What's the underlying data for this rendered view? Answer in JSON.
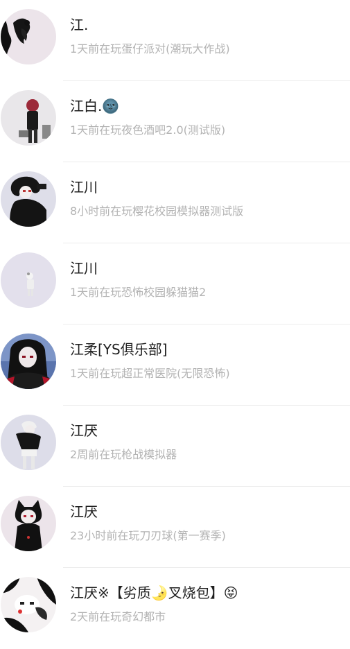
{
  "friends": [
    {
      "name": "江.",
      "status": "1天前在玩蛋仔派对(潮玩大作战)",
      "avatar_icon": "avatar-black-smoke-icon"
    },
    {
      "name": "江白.🌚",
      "status": "1天前在玩夜色酒吧2.0(测试版)",
      "avatar_icon": "avatar-red-hair-figure-icon"
    },
    {
      "name": "江川",
      "status": "8小时前在玩樱花校园模拟器测试版",
      "avatar_icon": "avatar-dark-hair-pose-icon"
    },
    {
      "name": "江川",
      "status": "1天前在玩恐怖校园躲猫猫2",
      "avatar_icon": "avatar-small-white-figure-icon"
    },
    {
      "name": "江柔[YS俱乐部]",
      "status": "1天前在玩超正常医院(无限恐怖)",
      "avatar_icon": "avatar-long-black-hair-icon"
    },
    {
      "name": "江厌",
      "status": "2周前在玩枪战模拟器",
      "avatar_icon": "avatar-white-hair-figure-icon"
    },
    {
      "name": "江厌",
      "status": "23小时前在玩刀刃球(第一赛季)",
      "avatar_icon": "avatar-cat-ear-figure-icon"
    },
    {
      "name": "江厌※【劣质🌛叉烧包】😝",
      "status": "2天前在玩奇幻都市",
      "avatar_icon": "avatar-bw-face-icon"
    }
  ]
}
